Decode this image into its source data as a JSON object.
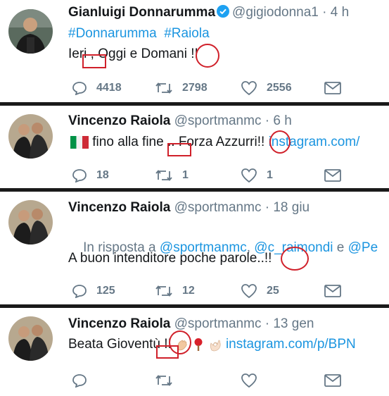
{
  "tweets": [
    {
      "name": "Gianluigi Donnarumma",
      "verified": true,
      "handle": "@gigiodonna1",
      "sep": "·",
      "time": "4 h",
      "hashtags": "#Donnarumma  #Raiola",
      "text_a": "Ieri",
      "text_b": " , Oggi e Domani",
      "text_c": " !!",
      "actions": {
        "reply": "4418",
        "retweet": "2798",
        "like": "2556"
      }
    },
    {
      "name": "Vincenzo Raiola",
      "handle": "@sportmanmc",
      "sep": "·",
      "time": "6 h",
      "text_a": " fino alla fine",
      "text_b": " .. ",
      "text_c": "Forza Azzurri",
      "text_d": "!!",
      "link": " instagram.com/",
      "actions": {
        "reply": "18",
        "retweet": "1",
        "like": "1"
      }
    },
    {
      "name": "Vincenzo Raiola",
      "handle": "@sportmanmc",
      "sep": "·",
      "time": "18 giu",
      "reply_prefix": "In risposta a ",
      "reply_to_1": "@sportmanmc",
      "reply_sep": ", ",
      "reply_to_2": "@c_raimondi",
      "reply_and": " e ",
      "reply_to_3": "@Pe",
      "text_a": "A buon intenditore poche parole",
      "text_b": "..",
      "text_c": "!!",
      "actions": {
        "reply": "125",
        "retweet": "12",
        "like": "25"
      }
    },
    {
      "name": "Vincenzo Raiola",
      "handle": "@sportmanmc",
      "sep": "·",
      "time": "13 gen",
      "text_a": "Beata Gioventù",
      "text_b": " !!",
      "link": " instagram.com/p/BPN",
      "actions": {
        "reply": "",
        "retweet": "",
        "like": ""
      }
    }
  ],
  "colors": {
    "annotation": "#d0202a",
    "link": "#1b95e0",
    "muted": "#657786",
    "divider": "#1a1a1a"
  },
  "icons": [
    "verified-badge-icon",
    "reply-icon",
    "retweet-icon",
    "like-icon",
    "message-icon",
    "italy-flag-icon",
    "clap-icon",
    "ping-pong-icon",
    "ok-hand-icon"
  ]
}
